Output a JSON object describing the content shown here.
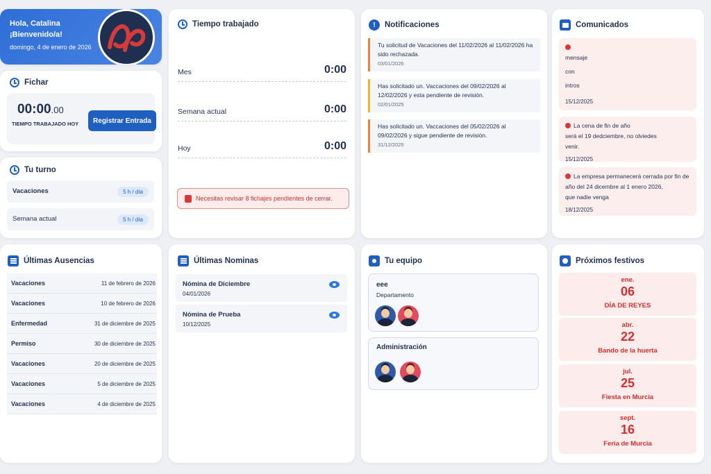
{
  "welcome": {
    "greeting": "Hola, Catalina",
    "welcome": "¡Bienvenido/a!",
    "date": "domingo, 4 de enero de 2026"
  },
  "fichar": {
    "title": "Fichar",
    "time_main": "00:00",
    "time_sec": ".00",
    "time_label": "TIEMPO TRABAJADO HOY",
    "button": "Registrar Entrada"
  },
  "turno": {
    "title": "Tu turno",
    "rows": [
      {
        "label": "Vacaciones",
        "badge": "5 h / día"
      },
      {
        "label": "Semana actual",
        "badge": "5 h / día"
      }
    ]
  },
  "tiempo": {
    "title": "Tiempo trabajado",
    "rows": [
      {
        "label": "Mes",
        "value": "0:00"
      },
      {
        "label": "Semana actual",
        "value": "0:00"
      },
      {
        "label": "Hoy",
        "value": "0:00"
      }
    ],
    "alert": "Necesitas revisar 8 fichajes pendientes de cerrar."
  },
  "notificaciones": {
    "title": "Notificaciones",
    "items": [
      {
        "text": "Tu solicitud de Vacaciones del 11/02/2026 al 11/02/2026 ha sido rechazada.",
        "date": "03/01/2026",
        "color": "#e9853a"
      },
      {
        "text": "Has solicitado un. Vaccaciones del 09/02/2026 al 12/02/2026 y esta pendiente de revisión.",
        "date": "02/01/2025",
        "color": "#f0b429"
      },
      {
        "text": "Has solicitado un. Vaccaciones del 05/02/2026 al 09/02/2026 y sigue pendiente de revisión.",
        "date": "31/12/2025",
        "color": "#e9853a"
      }
    ]
  },
  "comunicados": {
    "title": "Comunicados",
    "items": [
      {
        "lines": [
          "mensaje",
          "con",
          "intros"
        ],
        "date": "15/12/2025"
      },
      {
        "lines": [
          "La cena de fin de año",
          "será el 19 dedciembre, no olviedes",
          "venir."
        ],
        "date": "15/12/2025"
      },
      {
        "lines": [
          "La empresa permanecerá cerrada por fin de",
          "año del 24 dicembre al 1 enero 2026,",
          "que nadie venga"
        ],
        "date": "18/12/2025"
      }
    ]
  },
  "ausencias": {
    "title": "Últimas Ausencias",
    "rows": [
      {
        "type": "Vacaciones",
        "date": "11 de febrero de 2026"
      },
      {
        "type": "Vacaciones",
        "date": "10 de febrero de 2026"
      },
      {
        "type": "Enfermedad",
        "date": "31 de diciembre de 2025"
      },
      {
        "type": "Permiso",
        "date": "30 de diciembre de 2025"
      },
      {
        "type": "Vacaciones",
        "date": "20 de diciembre de 2025"
      },
      {
        "type": "Vacaciones",
        "date": "5 de diciembre de 2025"
      },
      {
        "type": "Vacaciones",
        "date": "4 de diciembre de 2025"
      }
    ]
  },
  "nominas": {
    "title": "Últimas Nominas",
    "rows": [
      {
        "name": "Nómina de Diciembre",
        "date": "04/01/2026"
      },
      {
        "name": "Nómina de Prueba",
        "date": "10/12/2025"
      }
    ]
  },
  "equipo": {
    "title": "Tu equipo",
    "teams": [
      {
        "name": "eee",
        "dept": "Departamento"
      },
      {
        "name": "Administración",
        "dept": ""
      }
    ]
  },
  "festivos": {
    "title": "Próximos festivos",
    "items": [
      {
        "month": "ene.",
        "day": "06",
        "name": "DÍA DE REYES"
      },
      {
        "month": "abr.",
        "day": "22",
        "name": "Bando de la huerta"
      },
      {
        "month": "jul.",
        "day": "25",
        "name": "Fiesta en Murcia"
      },
      {
        "month": "sept.",
        "day": "16",
        "name": "Feria de Murcia"
      }
    ]
  }
}
